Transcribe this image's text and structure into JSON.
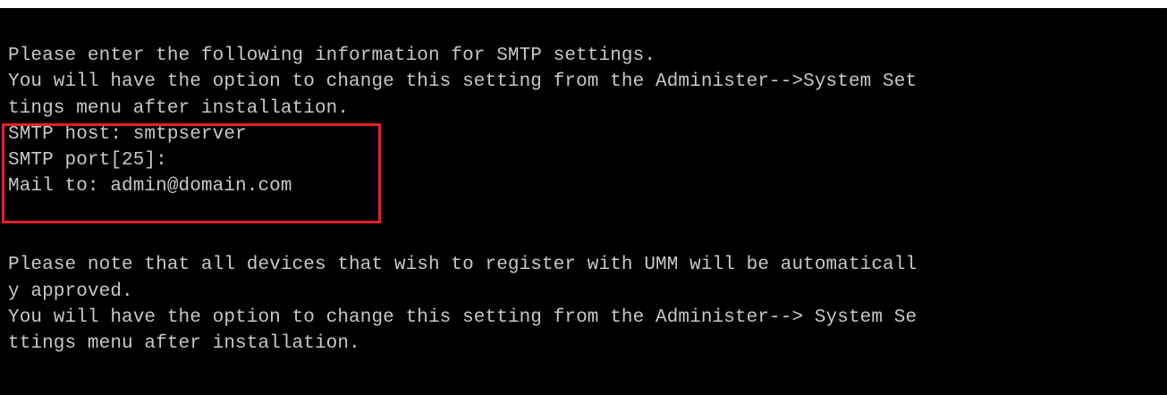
{
  "terminal": {
    "lines": [
      "Please enter the following information for SMTP settings.",
      "You will have the option to change this setting from the Administer-->System Set",
      "tings menu after installation.",
      "SMTP host: smtpserver",
      "SMTP port[25]:",
      "Mail to: admin@domain.com",
      "",
      "",
      "Please note that all devices that wish to register with UMM will be automaticall",
      "y approved.",
      "You will have the option to change this setting from the Administer--> System Se",
      "ttings menu after installation."
    ]
  },
  "annotation": {
    "highlight_color": "#e2222c"
  }
}
